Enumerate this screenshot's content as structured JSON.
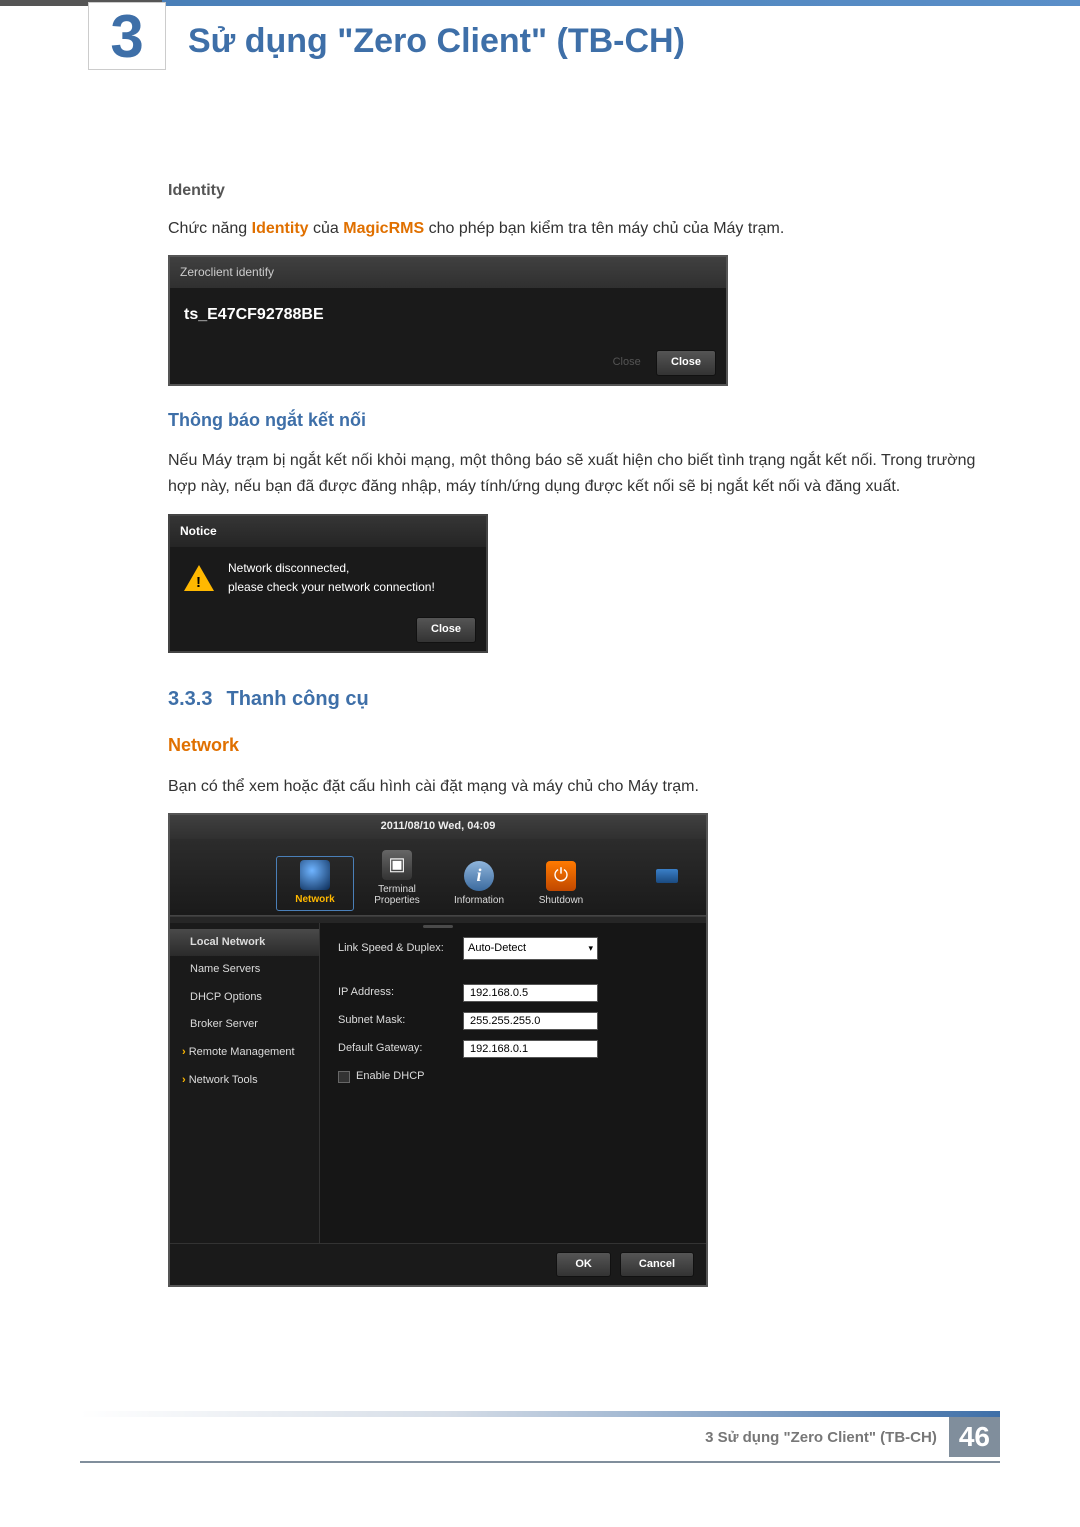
{
  "header": {
    "chapter_number": "3",
    "chapter_title": "Sử dụng \"Zero Client\" (TB-CH)"
  },
  "identity": {
    "heading": "Identity",
    "para_pre": "Chức năng ",
    "para_bold1": "Identity",
    "para_mid": " của ",
    "para_bold2": "MagicRMS",
    "para_post": " cho phép bạn kiểm tra tên máy chủ của Máy trạm.",
    "dialog": {
      "title": "Zeroclient identify",
      "host": "ts_E47CF92788BE",
      "ghost_btn": "Close",
      "close_btn": "Close"
    }
  },
  "disconnect": {
    "heading": "Thông báo ngắt kết nối",
    "para": "Nếu Máy trạm bị ngắt kết nối khỏi mạng, một thông báo sẽ xuất hiện cho biết tình trạng ngắt kết nối. Trong trường hợp này, nếu bạn đã được đăng nhập, máy tính/ứng dụng được kết nối sẽ bị ngắt kết nối và đăng xuất.",
    "dialog": {
      "title": "Notice",
      "line1": "Network disconnected,",
      "line2": "please check your network connection!",
      "close_btn": "Close"
    }
  },
  "section": {
    "number": "3.3.3",
    "title": "Thanh công cụ"
  },
  "network": {
    "heading": "Network",
    "para": "Bạn có thể xem hoặc đặt cấu hình cài đặt mạng và máy chủ cho Máy trạm.",
    "dialog": {
      "timestamp": "2011/08/10 Wed, 04:09",
      "toolbar": {
        "network": "Network",
        "terminal": "Terminal Properties",
        "information": "Information",
        "shutdown": "Shutdown"
      },
      "sidebar": {
        "local_network": "Local Network",
        "name_servers": "Name Servers",
        "dhcp_options": "DHCP Options",
        "broker_server": "Broker Server",
        "remote_mgmt": "Remote Management",
        "network_tools": "Network Tools"
      },
      "form": {
        "link_speed_label": "Link Speed & Duplex:",
        "link_speed_value": "Auto-Detect",
        "ip_label": "IP Address:",
        "ip_value": "192.168.0.5",
        "subnet_label": "Subnet Mask:",
        "subnet_value": "255.255.255.0",
        "gateway_label": "Default Gateway:",
        "gateway_value": "192.168.0.1",
        "dhcp_label": "Enable DHCP"
      },
      "footer": {
        "ok": "OK",
        "cancel": "Cancel"
      }
    }
  },
  "footer": {
    "text": "3 Sử dụng \"Zero Client\" (TB-CH)",
    "page": "46"
  }
}
